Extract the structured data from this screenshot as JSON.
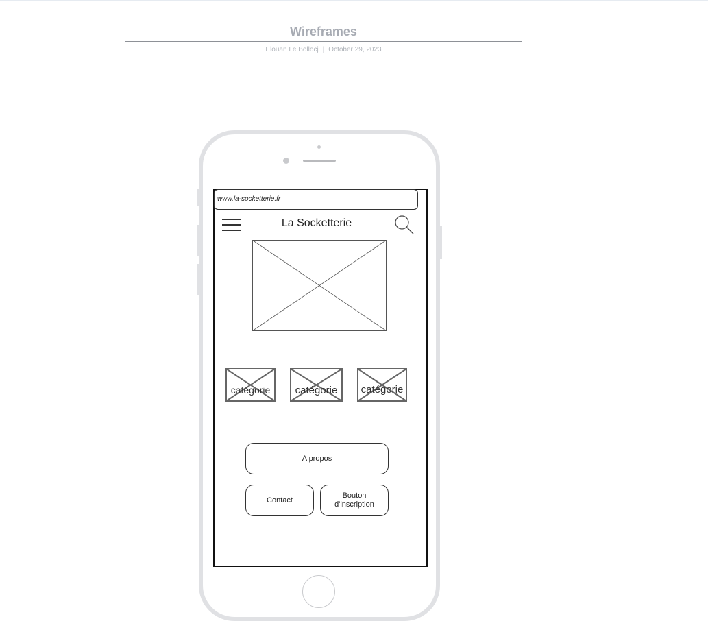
{
  "header": {
    "title": "Wireframes",
    "author": "Elouan Le Bollocj",
    "separator": "|",
    "date": "October 29, 2023"
  },
  "screen": {
    "url": "www.la-socketterie.fr",
    "app_title": "La Socketterie",
    "categories": [
      "catégorie",
      "catégorie",
      "catégorie"
    ],
    "buttons": {
      "about": "A propos",
      "contact": "Contact",
      "signup": "Bouton d'inscription"
    }
  },
  "icons": {
    "menu": "hamburger-menu-icon",
    "search": "magnifier-icon",
    "image_placeholder": "crossed-box"
  },
  "colors": {
    "phone_frame": "#e0e1e4",
    "wire_stroke": "#333333",
    "header_text": "#a7abb3"
  }
}
